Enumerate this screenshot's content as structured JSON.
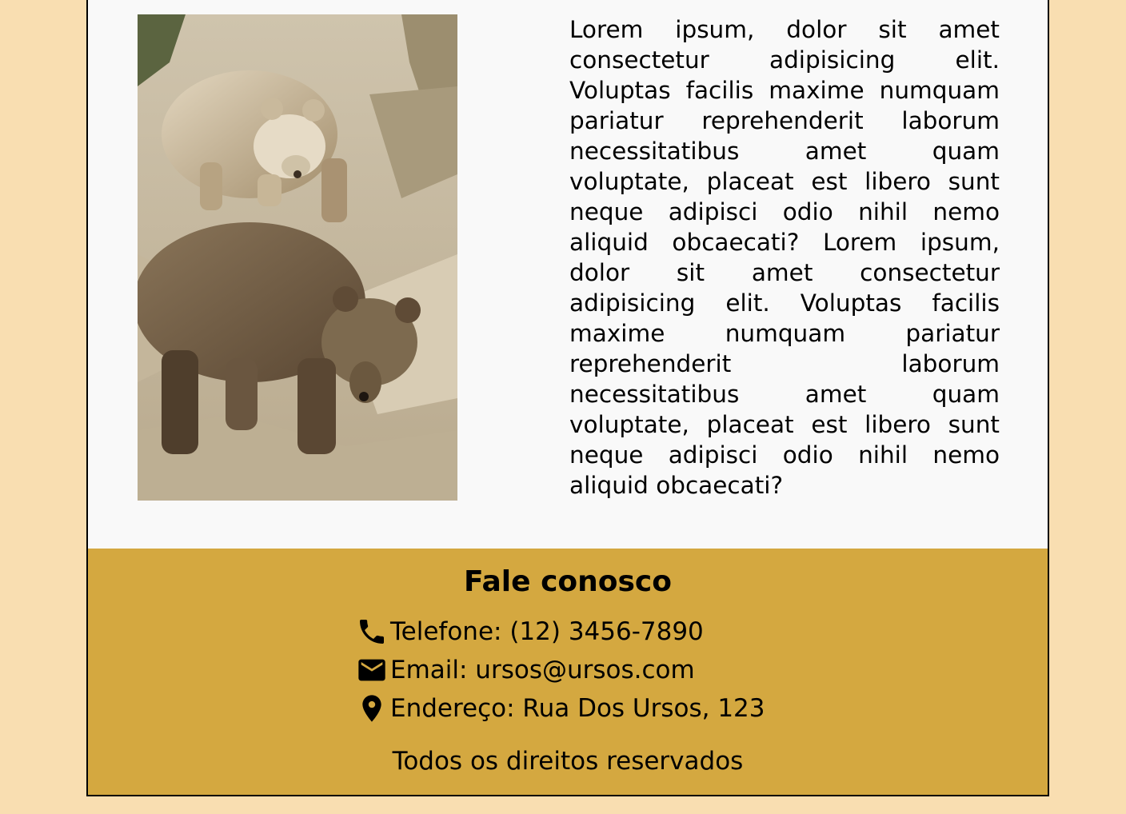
{
  "main": {
    "image_alt": "Dois ursos marrons sobre rochas",
    "paragraph": "Lorem ipsum, dolor sit amet consectetur adipisicing elit. Voluptas facilis maxime numquam pariatur reprehenderit laborum necessitatibus amet quam voluptate, placeat est libero sunt neque adipisci odio nihil nemo aliquid obcaecati? Lorem ipsum, dolor sit amet consectetur adipisicing elit. Voluptas facilis maxime numquam pariatur reprehenderit laborum necessitatibus amet quam voluptate, placeat est libero sunt neque adipisci odio nihil nemo aliquid obcaecati?"
  },
  "footer": {
    "title": "Fale conosco",
    "contacts": [
      {
        "icon": "phone-icon",
        "text": "Telefone: (12) 3456-7890"
      },
      {
        "icon": "mail-icon",
        "text": "Email: ursos@ursos.com"
      },
      {
        "icon": "location-pin-icon",
        "text": "Endereço: Rua Dos Ursos, 123"
      }
    ],
    "copyright": "Todos os direitos reservados"
  },
  "colors": {
    "page_background": "#f9deb1",
    "content_background": "#f9f9f9",
    "footer_background": "#d4a840"
  }
}
